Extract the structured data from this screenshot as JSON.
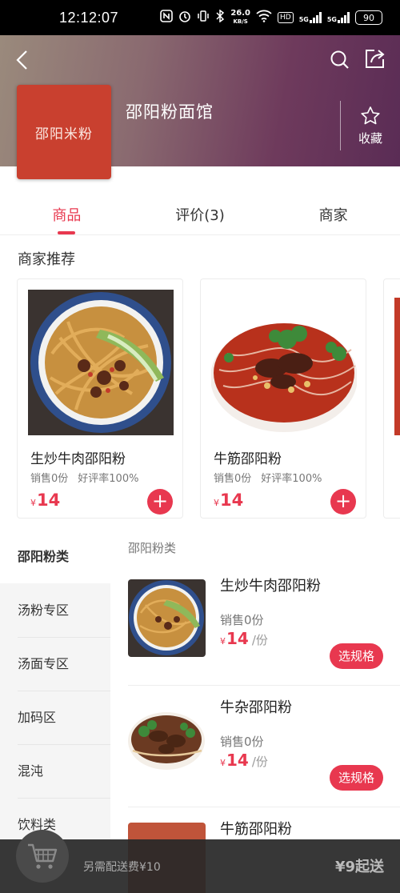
{
  "status_bar": {
    "time": "12:12:07",
    "net_speed": "26.0",
    "net_unit": "KB/S",
    "hd_label": "HD",
    "sim1": "5G",
    "sim2": "5G",
    "battery": "90"
  },
  "header": {
    "logo_text": "邵阳米粉",
    "shop_name": "邵阳粉面馆",
    "favorite_label": "收藏",
    "icons": [
      "back-arrow-icon",
      "search-icon",
      "share-icon",
      "star-icon"
    ]
  },
  "tabs": [
    {
      "label": "商品",
      "active": true
    },
    {
      "label": "评价(3)",
      "active": false
    },
    {
      "label": "商家",
      "active": false
    }
  ],
  "recommend": {
    "title": "商家推荐",
    "currency": "¥",
    "items": [
      {
        "name": "生炒牛肉邵阳粉",
        "sales": "销售0份",
        "rating": "好评率100%",
        "price": "14"
      },
      {
        "name": "牛筋邵阳粉",
        "sales": "销售0份",
        "rating": "好评率100%",
        "price": "14"
      }
    ]
  },
  "categories": [
    {
      "label": "邵阳粉类",
      "active": true
    },
    {
      "label": "汤粉专区",
      "active": false
    },
    {
      "label": "汤面专区",
      "active": false
    },
    {
      "label": "加码区",
      "active": false
    },
    {
      "label": "混沌",
      "active": false
    },
    {
      "label": "饮料类",
      "active": false
    }
  ],
  "menu": {
    "group_title": "邵阳粉类",
    "currency": "¥",
    "unit": "/份",
    "spec_label": "选规格",
    "items": [
      {
        "name": "生炒牛肉邵阳粉",
        "sales": "销售0份",
        "price": "14"
      },
      {
        "name": "牛杂邵阳粉",
        "sales": "销售0份",
        "price": "14"
      },
      {
        "name": "牛筋邵阳粉",
        "sales": "",
        "price": ""
      }
    ]
  },
  "cart_bar": {
    "delivery_fee_text": "另需配送费¥10",
    "min_order_text": "¥9起送"
  },
  "colors": {
    "accent": "#e8384f",
    "logo_bg": "#c9402f"
  }
}
